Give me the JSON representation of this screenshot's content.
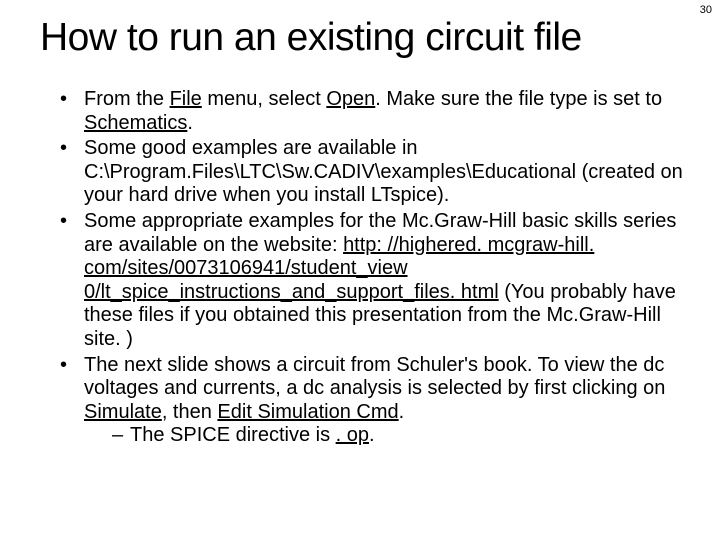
{
  "page_number": "30",
  "title": "How to run an existing circuit file",
  "b1": {
    "a": "From the ",
    "file": "File",
    "b": " menu, select ",
    "open": "Open",
    "c": ". Make sure the file type is set to ",
    "schem": "Schematics",
    "d": "."
  },
  "b2": "Some good examples are available in C:\\Program.Files\\LTC\\Sw.CADIV\\examples\\Educational (created on your hard drive when you install LTspice).",
  "b3": {
    "a": "Some appropriate examples for the Mc.Graw-Hill basic skills series are available on the website: ",
    "link": "http: //highered. mcgraw-hill. com/sites/0073106941/student_view 0/lt_spice_instructions_and_support_files. html",
    "b": " (You probably have these files if you obtained this presentation from the Mc.Graw-Hill site. )"
  },
  "b4": {
    "a": "The next slide shows a circuit from Schuler's book. To view the dc voltages and currents, a dc analysis is selected by first clicking on ",
    "sim": "Simulate",
    "b": ", then ",
    "edit": "Edit Simulation Cmd",
    "c": "."
  },
  "sub": {
    "a": "The SPICE directive is ",
    "op": ". op",
    "b": "."
  }
}
